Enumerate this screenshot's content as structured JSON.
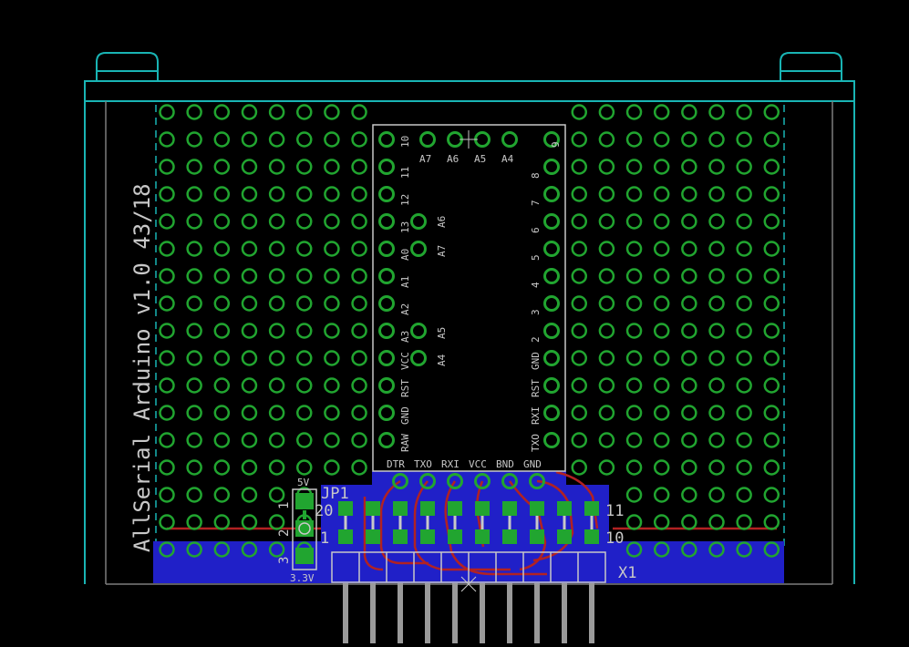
{
  "board_text": "AllSerial Arduino v1.0  43/18",
  "colors": {
    "background": "#000000",
    "pad": "#21a530",
    "outline": "#19b4b4",
    "silkscreen": "#c8c8c8",
    "bottom_copper": "#2020c8",
    "top_copper": "#b22222",
    "pins": "#9a9a9a"
  },
  "module": {
    "top_label_row": "10",
    "top_right_label": "9",
    "top_labels": [
      "A7",
      "A6",
      "A5",
      "A4"
    ],
    "left_labels": [
      "11",
      "12",
      "13",
      "A0",
      "A1",
      "A2",
      "A3",
      "VCC",
      "RST",
      "GND",
      "RAW"
    ],
    "right_labels": [
      "8",
      "7",
      "6",
      "5",
      "4",
      "3",
      "2",
      "GND",
      "RST",
      "RXI",
      "TXO"
    ],
    "inner_labels": [
      "A6",
      "A7",
      "A5",
      "A4"
    ],
    "header_labels": [
      "DTR",
      "TXO",
      "RXI",
      "VCC",
      "BND",
      "GND"
    ]
  },
  "jumper": {
    "name": "JP1",
    "top_label": "5V",
    "bottom_label": "3.3V",
    "pins": [
      "1",
      "2",
      "3"
    ]
  },
  "connector": {
    "name": "X1",
    "row_labels": [
      "20",
      "1",
      "11",
      "10"
    ]
  }
}
